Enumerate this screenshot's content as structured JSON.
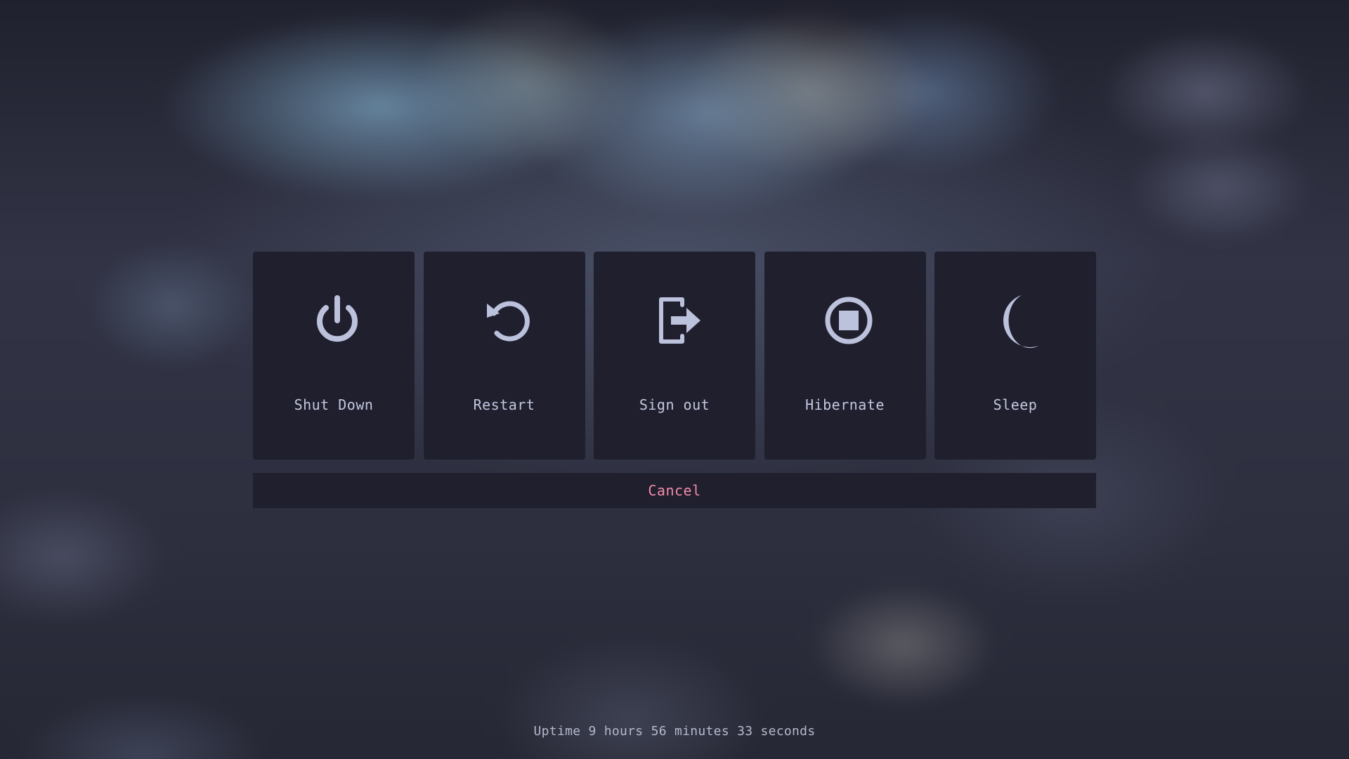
{
  "power_menu": {
    "actions": [
      {
        "label": "Shut Down",
        "icon": "power-icon"
      },
      {
        "label": "Restart",
        "icon": "restart-icon"
      },
      {
        "label": "Sign out",
        "icon": "sign-out-icon"
      },
      {
        "label": "Hibernate",
        "icon": "hibernate-icon"
      },
      {
        "label": "Sleep",
        "icon": "moon-icon"
      }
    ],
    "cancel_label": "Cancel",
    "uptime": "Uptime 9 hours 56 minutes 33 seconds"
  },
  "colors": {
    "panel": "#1f1f2e",
    "label": "#c3c8df",
    "icon": "#bcc1dc",
    "cancel": "#f38ba8"
  }
}
